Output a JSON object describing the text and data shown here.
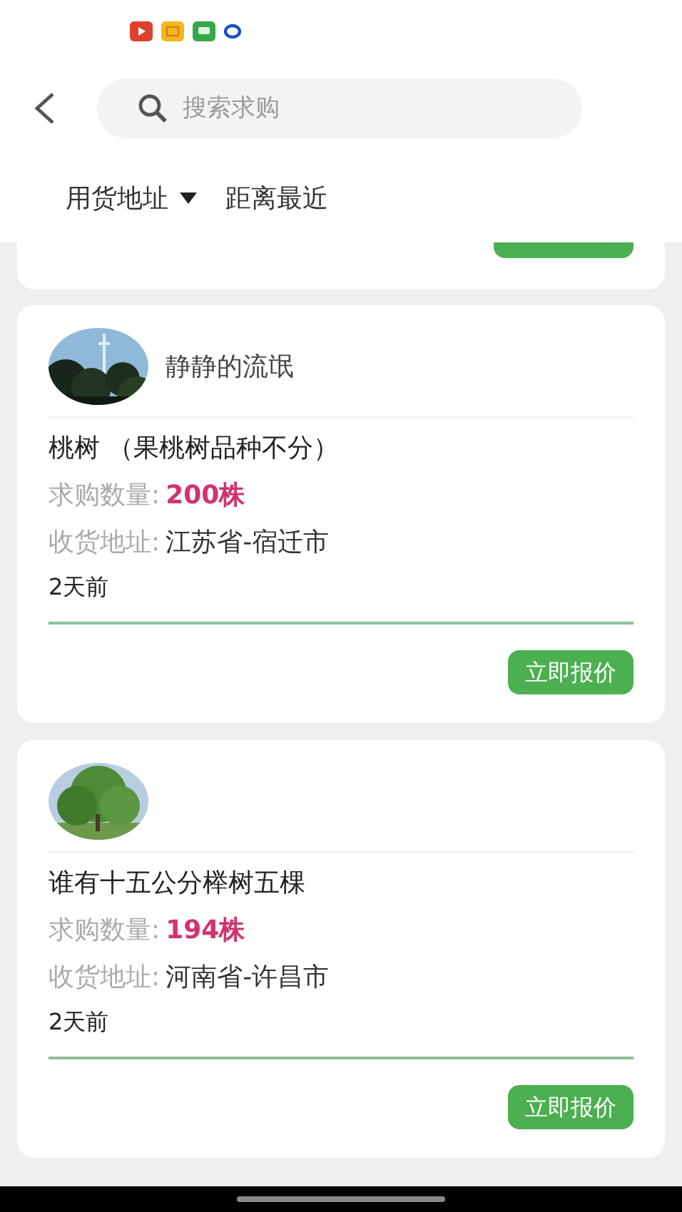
{
  "search": {
    "placeholder": "搜索求购"
  },
  "filters": [
    {
      "label": "用货地址",
      "dropdown": true
    },
    {
      "label": "距离最近",
      "dropdown": false
    }
  ],
  "posts": [
    {
      "user": "静静的流氓",
      "title": "桃树 （果桃树品种不分）",
      "quantity_label": "求购数量:",
      "quantity": "200株",
      "address_label": "收货地址:",
      "address": "江苏省-宿迁市",
      "time": "2天前",
      "button": "立即报价"
    },
    {
      "title": "谁有十五公分榉树五棵",
      "quantity_label": "求购数量:",
      "quantity": "194株",
      "address_label": "收货地址:",
      "address": "河南省-许昌市",
      "time": "2天前",
      "button": "立即报价"
    }
  ]
}
